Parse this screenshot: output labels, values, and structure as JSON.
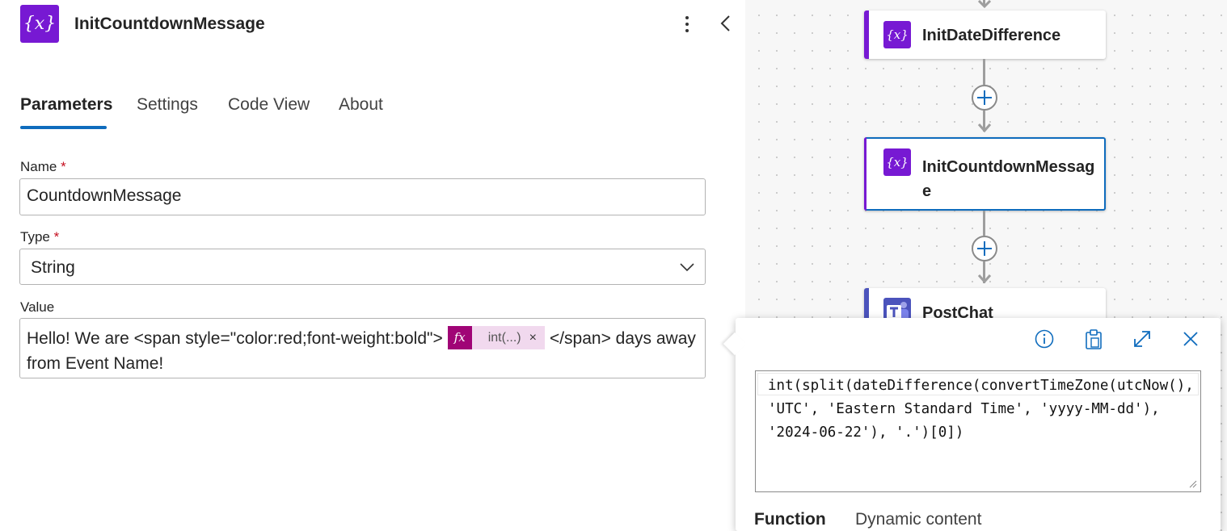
{
  "panel": {
    "icon_text": "{x}",
    "title": "InitCountdownMessage",
    "tabs": [
      {
        "label": "Parameters",
        "active": true
      },
      {
        "label": "Settings",
        "active": false
      },
      {
        "label": "Code View",
        "active": false
      },
      {
        "label": "About",
        "active": false
      }
    ],
    "fields": {
      "name": {
        "label": "Name",
        "required_mark": "*",
        "value": "CountdownMessage"
      },
      "type": {
        "label": "Type",
        "required_mark": "*",
        "value": "String"
      },
      "value": {
        "label": "Value",
        "text_before": "Hello! We are <span style=\"color:red;font-weight:bold\">",
        "token_icon": "fx",
        "token_label": "int(...)",
        "token_remove": "×",
        "text_after": "</span> days away from Event Name!"
      }
    }
  },
  "canvas": {
    "nodes": [
      {
        "icon_text": "{x}",
        "label": "InitDateDifference",
        "selected": false
      },
      {
        "icon_text": "{x}",
        "label": "InitCountdownMessage",
        "selected": true
      },
      {
        "icon": "teams-icon",
        "label": "PostChat",
        "selected": false
      }
    ]
  },
  "expression_popup": {
    "expression": "int(split(dateDifference(convertTimeZone(utcNow(), 'UTC', 'Eastern Standard Time', 'yyyy-MM-dd'), '2024-06-22'), '.')[0])",
    "tabs": [
      {
        "label": "Function",
        "active": true
      },
      {
        "label": "Dynamic content",
        "active": false
      }
    ],
    "icons": [
      "info-icon",
      "clipboard-icon",
      "expand-icon",
      "close-icon"
    ]
  },
  "colors": {
    "variable_accent": "#7719d3",
    "expression_token": "#a00476",
    "selection_blue": "#0f6cbd",
    "required": "#c50f1f"
  }
}
